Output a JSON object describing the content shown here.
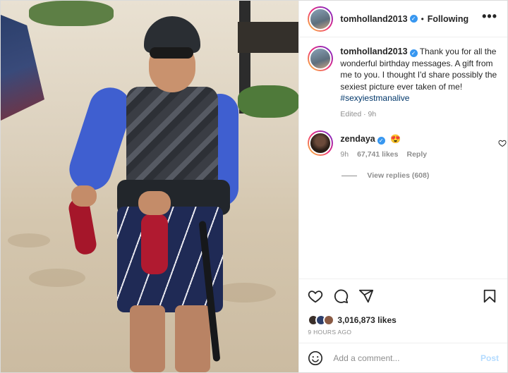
{
  "post": {
    "author": "tomholland2013",
    "follow_status": "Following",
    "more_label": "•••"
  },
  "caption": {
    "author": "tomholland2013",
    "text": "Thank you for all the wonderful birthday messages. A gift from me to you. I thought I'd share possibly the sexiest picture ever taken of me!",
    "hashtag": "#sexyiestmanalive",
    "edited": "Edited · 9h"
  },
  "comment": {
    "author": "zendaya",
    "emoji": "😍",
    "time": "9h",
    "likes": "67,741 likes",
    "reply_label": "Reply",
    "view_replies": "View replies (608)"
  },
  "actions": {
    "likes_count": "3,016,873 likes",
    "time_ago": "9 HOURS AGO"
  },
  "comment_input": {
    "placeholder": "Add a comment...",
    "post_label": "Post"
  },
  "icons": {
    "verified": "verified-badge-icon",
    "like": "heart-icon",
    "comment": "comment-icon",
    "share": "share-icon",
    "save": "bookmark-icon",
    "emoji": "smiley-icon"
  },
  "colors": {
    "accent_blue": "#3897f0",
    "post_disabled": "#b3dbff",
    "hashtag": "#00376b"
  }
}
